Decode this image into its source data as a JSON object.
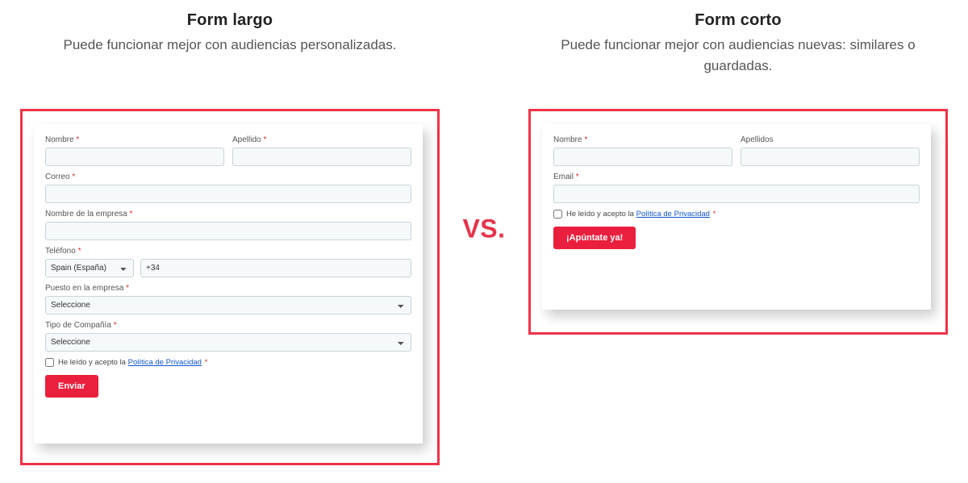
{
  "heads": {
    "left": {
      "title": "Form largo",
      "desc": "Puede funcionar mejor con audiencias personalizadas."
    },
    "right": {
      "title": "Form corto",
      "desc": "Puede funcionar mejor con audiencias nuevas: similares o guardadas."
    }
  },
  "vs": "VS.",
  "long_form": {
    "first_name_label": "Nombre",
    "last_name_label": "Apellido",
    "email_label": "Correo",
    "company_label": "Nombre de la empresa",
    "phone_label": "Teléfono",
    "phone_country": "Spain (España)",
    "phone_prefix": "+34",
    "role_label": "Puesto en la empresa",
    "role_placeholder": "Seleccione",
    "ctype_label": "Tipo de Compañía",
    "ctype_placeholder": "Seleccione",
    "consent_prefix": "He leído y acepto la ",
    "consent_link": "Política de Privacidad",
    "submit": "Enviar"
  },
  "short_form": {
    "first_name_label": "Nombre",
    "last_name_label": "Apellidos",
    "email_label": "Email",
    "consent_prefix": "He leído y acepto la ",
    "consent_link": "Política de Privacidad",
    "submit": "¡Apúntate ya!"
  }
}
